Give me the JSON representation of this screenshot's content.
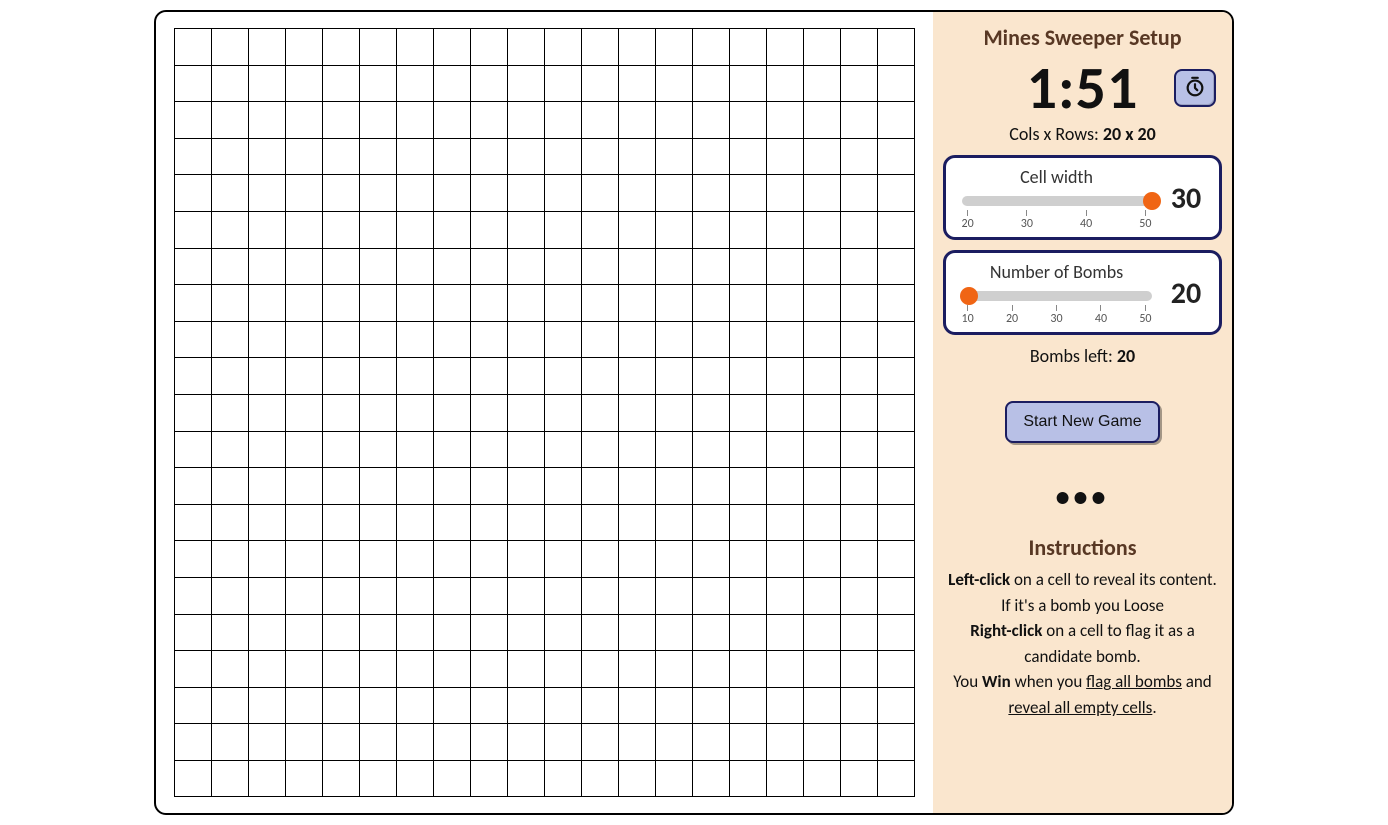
{
  "colors": {
    "panel_bg": "#fae6ce",
    "card_border": "#1b1d60",
    "btn_bg": "#b8c0e6",
    "accent": "#f06514"
  },
  "board": {
    "cols": 20,
    "rows": 21
  },
  "panel": {
    "title": "Mines Sweeper Setup",
    "timer": "1:51",
    "dims_label": "Cols x Rows: ",
    "dims_value": "20 x 20",
    "cell_width": {
      "label": "Cell width",
      "value": "30",
      "min": 20,
      "max": 50,
      "thumb_percent": 100,
      "ticks": [
        "20",
        "30",
        "40",
        "50"
      ]
    },
    "bombs": {
      "label": "Number of Bombs",
      "value": "20",
      "min": 10,
      "max": 50,
      "thumb_percent": 4,
      "ticks": [
        "10",
        "20",
        "30",
        "40",
        "50"
      ]
    },
    "bombs_left_label": "Bombs left: ",
    "bombs_left_value": "20",
    "start_label": "Start New Game",
    "dots": "•••",
    "instructions_title": "Instructions",
    "instr": {
      "left_bold": "Left-click",
      "left_rest": " on a cell to reveal its content. If it's a bomb you Loose",
      "right_bold": "Right-click",
      "right_rest": " on a cell to flag it as a candidate bomb.",
      "win_pre": "You ",
      "win_bold": "Win",
      "win_mid": " when you ",
      "win_u1": "flag all bombs",
      "win_and": " and ",
      "win_u2": "reveal all empty cells",
      "win_end": "."
    }
  }
}
